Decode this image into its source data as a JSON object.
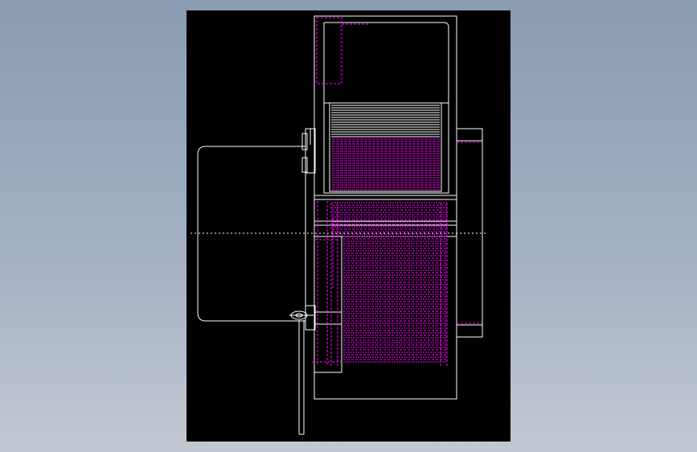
{
  "colors": {
    "background_top": "#8a9bb2",
    "background_bottom": "#c2c8d3",
    "canvas": "#000000",
    "outline": "#ffffff",
    "hidden_lines": "#ff00ff"
  },
  "drawing": {
    "view": "side elevation",
    "layers": [
      "outline",
      "hidden-lines",
      "centerline"
    ]
  }
}
